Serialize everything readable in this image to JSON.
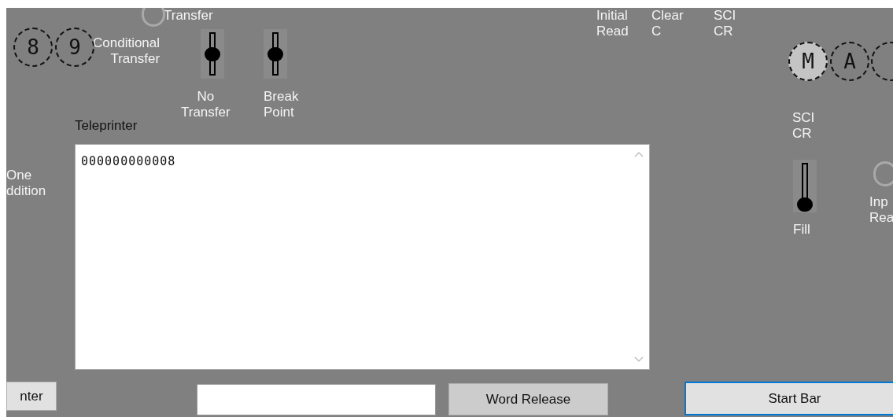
{
  "labels": [
    {
      "text": "Transfer"
    },
    {
      "text": "Conditional Transfer"
    },
    {
      "text": "No Transfer"
    },
    {
      "text": "Break Point"
    },
    {
      "text": "Teleprinter"
    },
    {
      "text": "Initial Read"
    },
    {
      "text": "Clear C"
    },
    {
      "text": "SCI CR"
    },
    {
      "text": "SCI CR"
    },
    {
      "text": "Fill"
    },
    {
      "text": "One ddition"
    },
    {
      "text": "Inp Rea"
    }
  ],
  "keys": [
    {
      "label": "8",
      "lit": false
    },
    {
      "label": "9",
      "lit": false
    },
    {
      "label": "M",
      "lit": true
    },
    {
      "label": "A",
      "lit": false
    },
    {
      "lit": false
    }
  ],
  "lamps": [
    {
      "lit": false
    },
    {
      "lit": false
    }
  ],
  "switches": [
    {
      "level": 0.5
    },
    {
      "level": 0.5
    },
    {
      "level": 0
    }
  ],
  "teleprinter": {
    "text": "000000000008"
  },
  "buttons": [
    {
      "label": "nter",
      "focused": false
    },
    {
      "label": "Word Release",
      "focused": false
    },
    {
      "label": "Start Bar",
      "focused": true
    }
  ]
}
